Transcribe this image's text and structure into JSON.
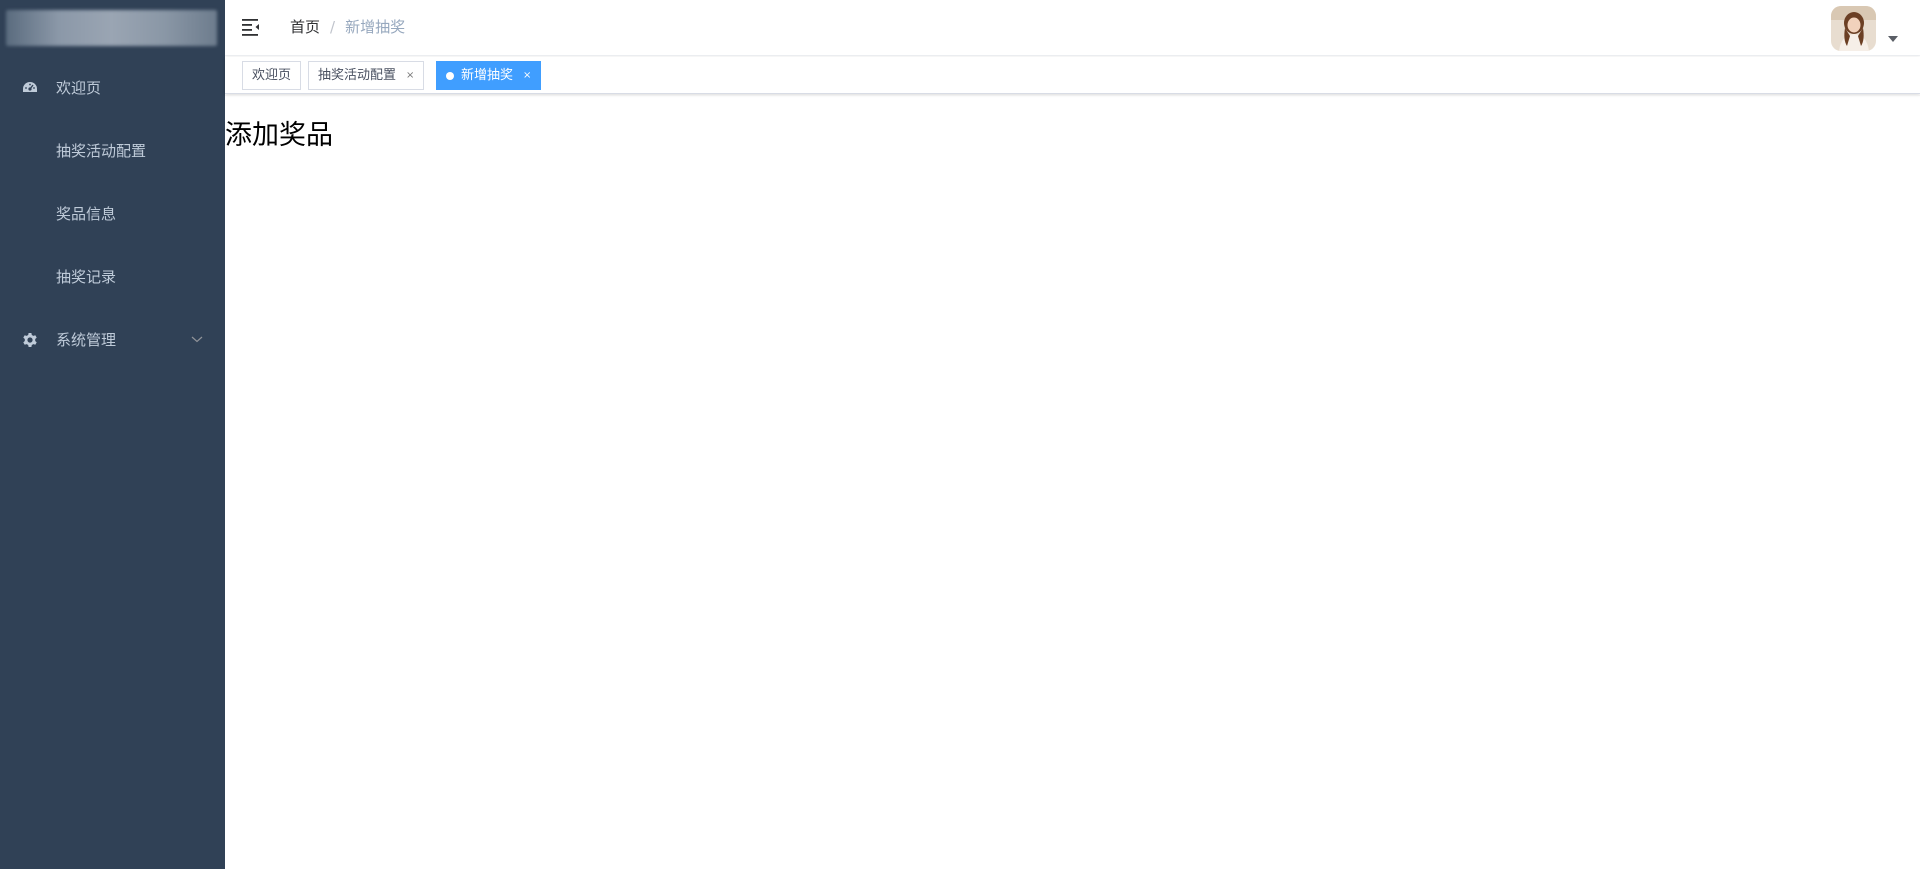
{
  "colors": {
    "sidebar_bg": "#304156",
    "sidebar_text": "#bfcbd9",
    "accent": "#409eff",
    "breadcrumb_current": "#97a8be"
  },
  "sidebar": {
    "items": [
      {
        "label": "欢迎页",
        "icon": "dashboard-icon"
      },
      {
        "label": "抽奖活动配置"
      },
      {
        "label": "奖品信息"
      },
      {
        "label": "抽奖记录"
      },
      {
        "label": "系统管理",
        "icon": "gear-icon",
        "expandable": true
      }
    ]
  },
  "navbar": {
    "breadcrumb": {
      "home": "首页",
      "separator": "/",
      "current": "新增抽奖"
    }
  },
  "tags": [
    {
      "label": "欢迎页",
      "closable": false,
      "active": false
    },
    {
      "label": "抽奖活动配置",
      "closable": true,
      "close": "×",
      "active": false
    },
    {
      "label": "新增抽奖",
      "closable": true,
      "close": "×",
      "active": true
    }
  ],
  "main": {
    "title": "添加奖品"
  }
}
